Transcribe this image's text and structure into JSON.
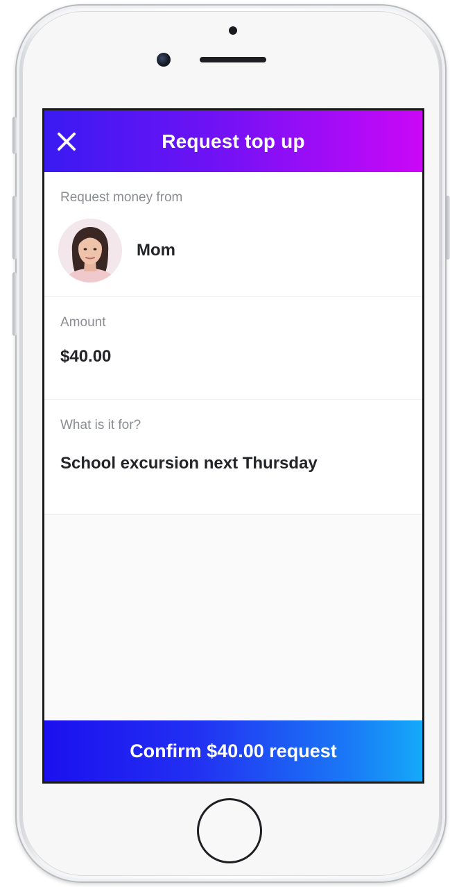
{
  "header": {
    "title": "Request top up",
    "close_icon": "close-icon"
  },
  "request_from": {
    "label": "Request money from",
    "contact_name": "Mom",
    "avatar_icon": "avatar"
  },
  "amount": {
    "label": "Amount",
    "value": "$40.00"
  },
  "purpose": {
    "label": "What is it for?",
    "value": "School excursion next Thursday"
  },
  "confirm": {
    "label": "Confirm $40.00 request"
  },
  "colors": {
    "header_gradient_start": "#3a1af2",
    "header_gradient_end": "#cb07f6",
    "button_gradient_start": "#1b10ef",
    "button_gradient_end": "#15a9f8"
  }
}
